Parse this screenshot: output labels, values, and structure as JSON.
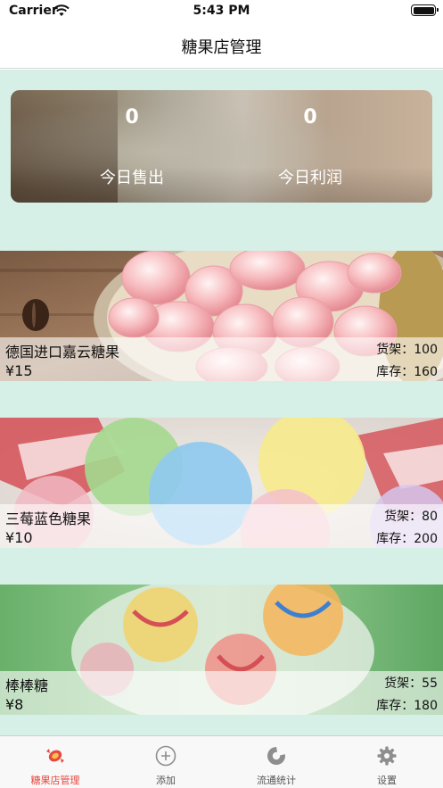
{
  "status_bar": {
    "carrier": "Carrier",
    "time": "5:43 PM"
  },
  "nav": {
    "title": "糖果店管理"
  },
  "summary": {
    "sold_value": "0",
    "sold_label": "今日售出",
    "profit_value": "0",
    "profit_label": "今日利润"
  },
  "products": [
    {
      "name": "德国进口嘉云糖果",
      "price": "¥15",
      "shelf": "货架：100",
      "stock": "库存：160"
    },
    {
      "name": "三莓蓝色糖果",
      "price": "¥10",
      "shelf": "货架：80",
      "stock": "库存：200"
    },
    {
      "name": "棒棒糖",
      "price": "¥8",
      "shelf": "货架：55",
      "stock": "库存：180"
    }
  ],
  "tabs": [
    {
      "label": "糖果店管理",
      "icon": "candy-icon",
      "active": true
    },
    {
      "label": "添加",
      "icon": "add-circle-icon",
      "active": false
    },
    {
      "label": "流通统计",
      "icon": "pie-chart-icon",
      "active": false
    },
    {
      "label": "设置",
      "icon": "gear-icon",
      "active": false
    }
  ],
  "colors": {
    "background": "#d6f0e8",
    "active_tab": "#e8483f",
    "inactive_tab": "#8e8e8e"
  }
}
